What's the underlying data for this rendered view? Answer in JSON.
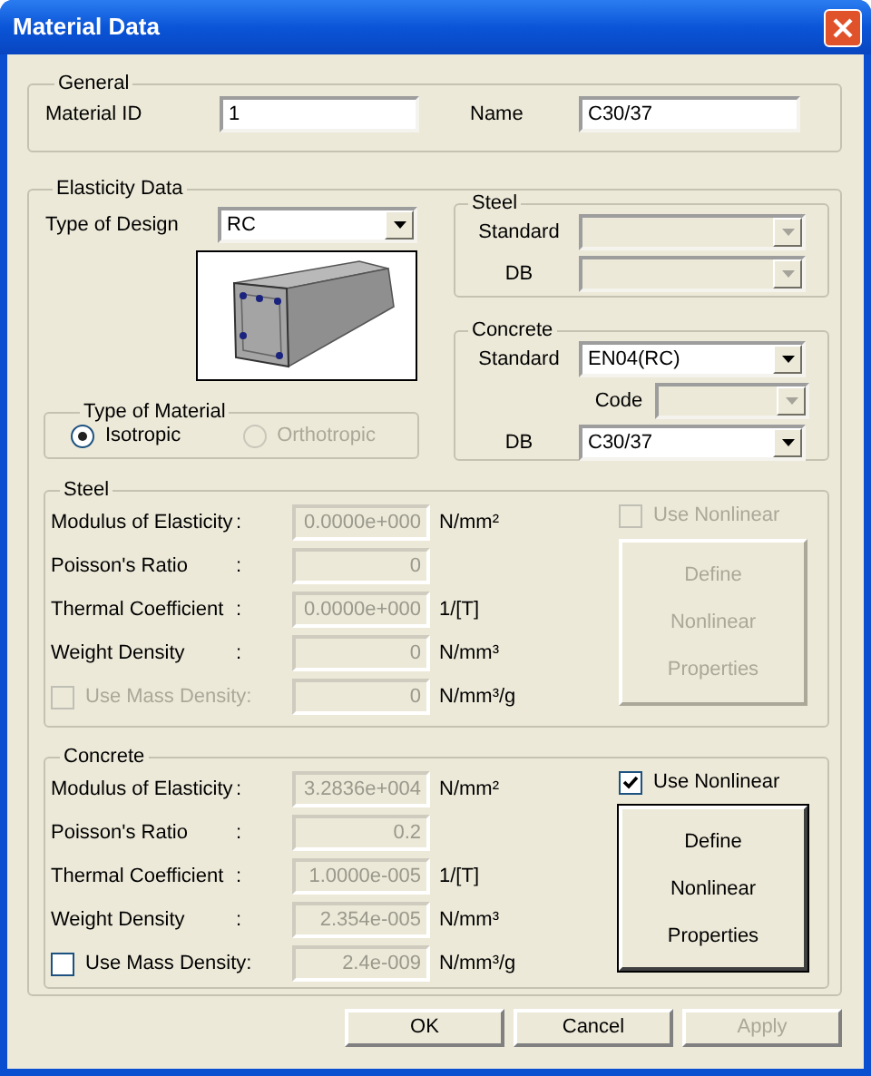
{
  "window": {
    "title": "Material Data"
  },
  "general": {
    "title": "General",
    "material_id": {
      "label": "Material ID",
      "value": "1"
    },
    "name": {
      "label": "Name",
      "value": "C30/37"
    }
  },
  "elasticity": {
    "title": "Elasticity Data",
    "type_of_design": {
      "label": "Type of Design",
      "value": "RC"
    },
    "type_of_material": {
      "title": "Type of Material",
      "options": [
        {
          "label": "Isotropic",
          "selected": true,
          "disabled": false
        },
        {
          "label": "Orthotropic",
          "selected": false,
          "disabled": true
        }
      ]
    },
    "steel_db": {
      "title": "Steel",
      "fields": [
        {
          "label": "Standard",
          "disabled": true
        },
        {
          "label": "DB",
          "disabled": true
        }
      ]
    },
    "concrete_db": {
      "title": "Concrete",
      "fields": [
        {
          "label": "Standard",
          "value": "EN04(RC)",
          "disabled": false
        },
        {
          "label": "Code",
          "disabled": true
        },
        {
          "label": "DB",
          "value": "C30/37",
          "disabled": false
        }
      ]
    },
    "steel": {
      "title": "Steel",
      "rows": [
        {
          "kind": "field",
          "label": "Modulus of Elasticity",
          "colon": ":",
          "value": "0.0000e+000",
          "unit": "N/mm²"
        },
        {
          "kind": "field",
          "label": "Poisson's Ratio",
          "colon": ":",
          "value": "0"
        },
        {
          "kind": "field",
          "label": "Thermal Coefficient",
          "colon": ":",
          "value": "0.0000e+000",
          "unit": "1/[T]"
        },
        {
          "kind": "field",
          "label": "Weight Density",
          "colon": ":",
          "value": "0",
          "unit": "N/mm³"
        },
        {
          "kind": "checkbox",
          "label": "Use Mass Density:",
          "checked": false,
          "disabled": true,
          "value": "0",
          "unit": "N/mm³/g"
        }
      ],
      "use_nonlinear": {
        "label": "Use Nonlinear",
        "checked": false,
        "disabled": true
      },
      "define_button": {
        "lines": [
          "Define",
          "Nonlinear",
          "Properties"
        ],
        "disabled": true
      }
    },
    "concrete": {
      "title": "Concrete",
      "rows": [
        {
          "kind": "field",
          "label": "Modulus of Elasticity",
          "colon": ":",
          "value": "3.2836e+004",
          "unit": "N/mm²"
        },
        {
          "kind": "field",
          "label": "Poisson's Ratio",
          "colon": ":",
          "value": "0.2"
        },
        {
          "kind": "field",
          "label": "Thermal Coefficient",
          "colon": ":",
          "value": "1.0000e-005",
          "unit": "1/[T]"
        },
        {
          "kind": "field",
          "label": "Weight Density",
          "colon": ":",
          "value": "2.354e-005",
          "unit": "N/mm³"
        },
        {
          "kind": "checkbox",
          "label": "Use Mass Density:",
          "checked": false,
          "disabled": false,
          "value": "2.4e-009",
          "unit": "N/mm³/g"
        }
      ],
      "use_nonlinear": {
        "label": "Use Nonlinear",
        "checked": true,
        "disabled": false
      },
      "define_button": {
        "lines": [
          "Define",
          "Nonlinear",
          "Properties"
        ],
        "disabled": false
      }
    }
  },
  "buttons": [
    {
      "label": "OK",
      "disabled": false
    },
    {
      "label": "Cancel",
      "disabled": false
    },
    {
      "label": "Apply",
      "disabled": true
    }
  ]
}
